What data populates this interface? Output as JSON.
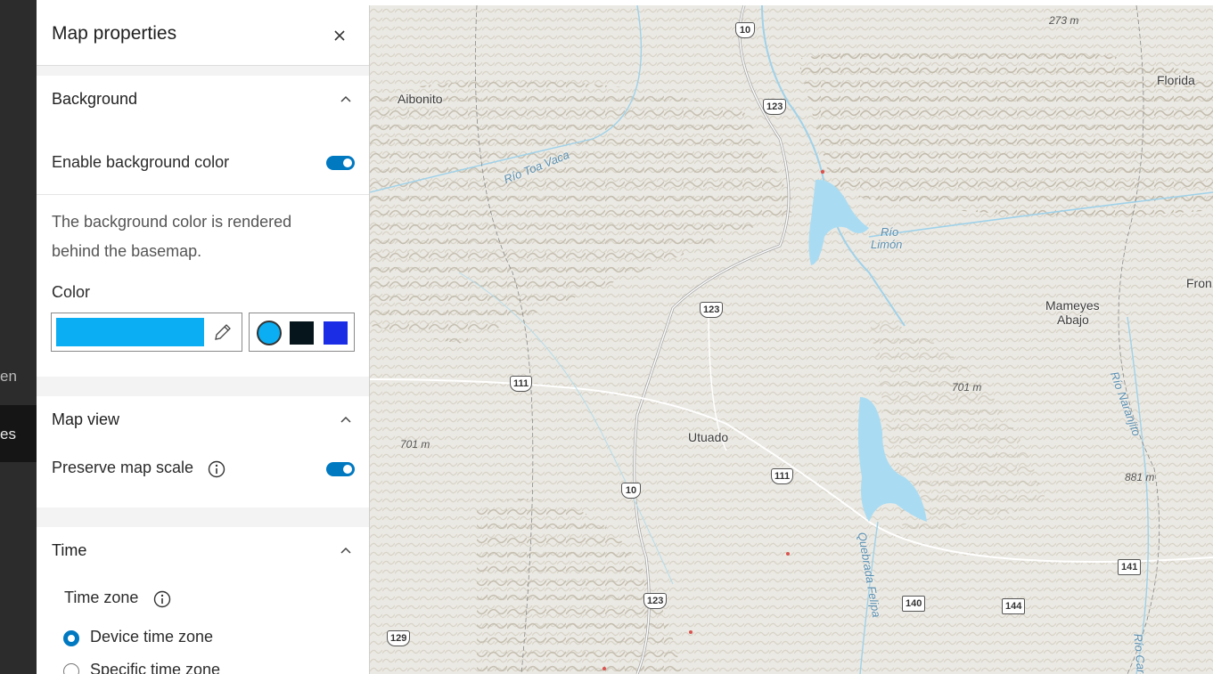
{
  "leftnav": {
    "items": [
      {
        "label": "en"
      },
      {
        "label": "es"
      }
    ]
  },
  "panel": {
    "title": "Map properties",
    "background": {
      "title": "Background",
      "enable_label": "Enable background color",
      "enabled": true,
      "description": "The background color is rendered behind the basemap.",
      "color_label": "Color",
      "current_color": "#0baef2",
      "swatches": [
        "#0baef2",
        "#06141b",
        "#1b2ee6"
      ]
    },
    "map_view": {
      "title": "Map view",
      "preserve_label": "Preserve map scale",
      "preserve_enabled": true
    },
    "time": {
      "title": "Time",
      "zone_label": "Time zone",
      "options": [
        {
          "label": "Device time zone",
          "selected": true
        },
        {
          "label": "Specific time zone",
          "selected": false
        }
      ]
    }
  },
  "map": {
    "places": [
      "Aibonito",
      "Florida",
      "Mameyes",
      "Abajo",
      "Utuado",
      "Fron"
    ],
    "water": [
      "Río Toa Vaca",
      "Río",
      "Limón",
      "Río Naranjito",
      "Quebrada Felipa",
      "Río Caro"
    ],
    "elevations": [
      "273 m",
      "701 m",
      "701 m",
      "881 m"
    ],
    "routes": [
      "10",
      "123",
      "123",
      "111",
      "111",
      "10",
      "123",
      "129",
      "140",
      "144",
      "141"
    ]
  },
  "colors": {
    "accent": "#0079c1",
    "sidebar": "#2c2c2c"
  }
}
